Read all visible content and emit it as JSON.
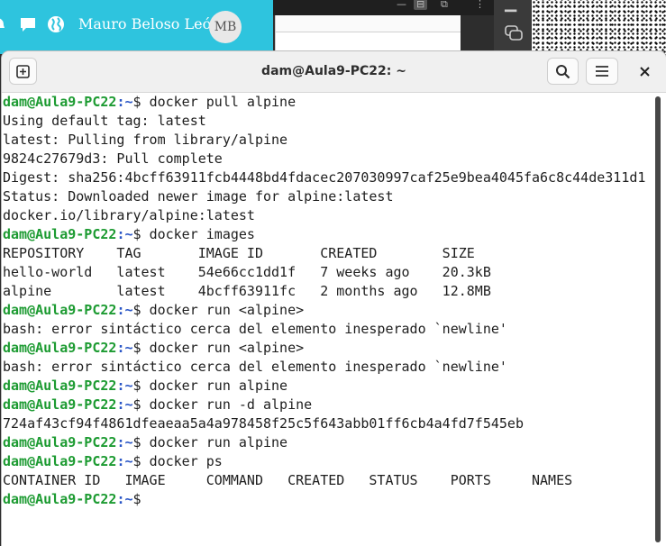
{
  "topbar": {
    "user_name": "Mauro Beloso León",
    "avatar_initials": "MB",
    "icons": [
      "bell-icon",
      "chat-icon",
      "globe-icon"
    ],
    "accent_color": "#2ec4de"
  },
  "terminal": {
    "title": "dam@Aula9-PC22: ~",
    "buttons": [
      "new-tab",
      "search",
      "menu",
      "close"
    ],
    "prompt_user": "dam@Aula9-PC22",
    "prompt_path": ":~",
    "prompt_symbol": "$ ",
    "lines": [
      {
        "kind": "cmd",
        "text": "docker pull alpine"
      },
      {
        "kind": "out",
        "text": "Using default tag: latest"
      },
      {
        "kind": "out",
        "text": "latest: Pulling from library/alpine"
      },
      {
        "kind": "out",
        "text": "9824c27679d3: Pull complete"
      },
      {
        "kind": "out",
        "text": "Digest: sha256:4bcff63911fcb4448bd4fdacec207030997caf25e9bea4045fa6c8c44de311d1"
      },
      {
        "kind": "out",
        "text": "Status: Downloaded newer image for alpine:latest"
      },
      {
        "kind": "out",
        "text": "docker.io/library/alpine:latest"
      },
      {
        "kind": "cmd",
        "text": "docker images"
      },
      {
        "kind": "out",
        "text": "REPOSITORY    TAG       IMAGE ID       CREATED        SIZE"
      },
      {
        "kind": "out",
        "text": "hello-world   latest    54e66cc1dd1f   7 weeks ago    20.3kB"
      },
      {
        "kind": "out",
        "text": "alpine        latest    4bcff63911fc   2 months ago   12.8MB"
      },
      {
        "kind": "cmd",
        "text": "docker run <alpine>"
      },
      {
        "kind": "out",
        "text": "bash: error sintáctico cerca del elemento inesperado `newline'"
      },
      {
        "kind": "cmd",
        "text": "docker run <alpine>"
      },
      {
        "kind": "out",
        "text": "bash: error sintáctico cerca del elemento inesperado `newline'"
      },
      {
        "kind": "cmd",
        "text": "docker run alpine"
      },
      {
        "kind": "cmd",
        "text": "docker run -d alpine"
      },
      {
        "kind": "out",
        "text": "724af43cf94f4861dfeaeaa5a4a978458f25c5f643abb01ff6cb4a4fd7f545eb"
      },
      {
        "kind": "cmd",
        "text": "docker run alpine"
      },
      {
        "kind": "cmd",
        "text": "docker ps"
      },
      {
        "kind": "out",
        "text": "CONTAINER ID   IMAGE     COMMAND   CREATED   STATUS    PORTS     NAMES"
      },
      {
        "kind": "cmd",
        "text": ""
      }
    ],
    "colors": {
      "prompt_user": "#1d9b32",
      "prompt_path": "#2a56c6",
      "text": "#1e1e1e"
    }
  }
}
